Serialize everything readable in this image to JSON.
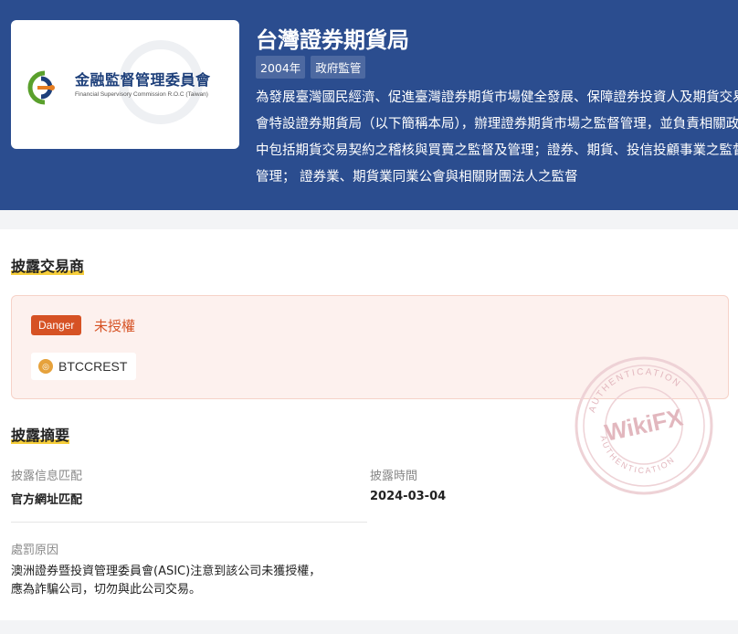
{
  "regulator": {
    "logo_zh": "金融監督管理委員會",
    "logo_en": "Financial Supervisory Commission R.O.C (Taiwan)",
    "title": "台灣證券期貨局",
    "tags": [
      "2004年",
      "政府監管"
    ],
    "description": "為發展臺灣國民經濟、促進臺灣證券期貨市場健全發展、保障證券投資人及期貨交易人權益，行政院金融監督管理委員會特設證券期貨局（以下簡稱本局），辦理證券期貨市場之監督管理，並負責相關政策、法規之規劃及執行等業務。 其中包括期貨交易契約之稽核與買賣之監督及管理；證券、期貨、投信投顧事業之監督及管理；證券與期貨市場之監督及管理； 證券業、期貨業同業公會與相關財團法人之監督"
  },
  "section_broker": {
    "title": "披露交易商",
    "badge": "Danger",
    "status": "未授權",
    "broker_name": "BTCCREST",
    "broker_icon": "coin-icon"
  },
  "section_summary": {
    "title": "披露摘要",
    "match_label": "披露信息匹配",
    "match_value": "官方網址匹配",
    "time_label": "披露時間",
    "time_value": "2024-03-04",
    "reason_label": "處罰原因",
    "reason_line1": "澳洲證券暨投資管理委員會(ASIC)注意到該公司未獲授權，",
    "reason_line2": "應為詐騙公司，切勿與此公司交易。"
  },
  "watermark": {
    "brand": "WikiFX",
    "arc_top": "AUTHENTICATION",
    "arc_bottom": "AUTHENTICATION"
  },
  "colors": {
    "hero_bg": "#2b4d8f",
    "danger": "#d65224",
    "danger_bg": "#fdf1ee",
    "highlight": "#f5c518",
    "stamp": "#e8b4bc"
  }
}
